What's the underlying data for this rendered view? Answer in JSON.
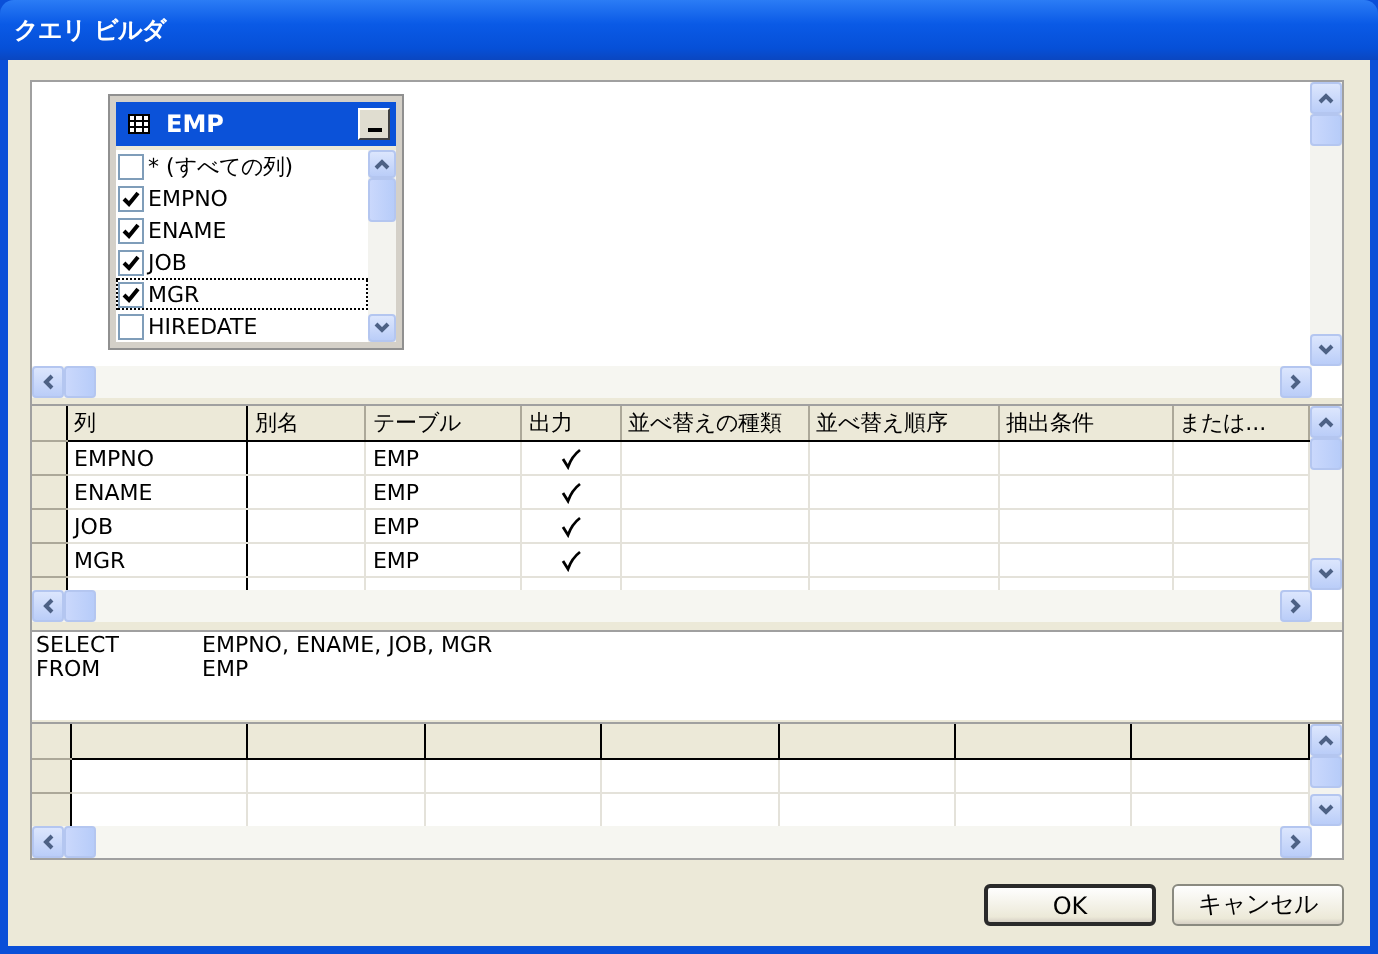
{
  "window": {
    "title": "クエリ ビルダ"
  },
  "diagram": {
    "tables": [
      {
        "name": "EMP",
        "columns": [
          {
            "name": "* (すべての列)",
            "checked": false,
            "focused": false
          },
          {
            "name": "EMPNO",
            "checked": true,
            "focused": false
          },
          {
            "name": "ENAME",
            "checked": true,
            "focused": false
          },
          {
            "name": "JOB",
            "checked": true,
            "focused": false
          },
          {
            "name": "MGR",
            "checked": true,
            "focused": true
          },
          {
            "name": "HIREDATE",
            "checked": false,
            "focused": false
          }
        ]
      }
    ]
  },
  "grid": {
    "columns": [
      "列",
      "別名",
      "テーブル",
      "出力",
      "並べ替えの種類",
      "並べ替え順序",
      "抽出条件",
      "または..."
    ],
    "rows": [
      {
        "column": "EMPNO",
        "table": "EMP",
        "output": true
      },
      {
        "column": "ENAME",
        "table": "EMP",
        "output": true
      },
      {
        "column": "JOB",
        "table": "EMP",
        "output": true
      },
      {
        "column": "MGR",
        "table": "EMP",
        "output": true
      }
    ]
  },
  "sql": {
    "lines": [
      {
        "keyword": "SELECT",
        "text": "EMPNO, ENAME, JOB, MGR"
      },
      {
        "keyword": "FROM",
        "text": "EMP"
      }
    ]
  },
  "buttons": [
    {
      "label": "OK",
      "default": true
    },
    {
      "label": "キャンセル",
      "default": false
    }
  ]
}
